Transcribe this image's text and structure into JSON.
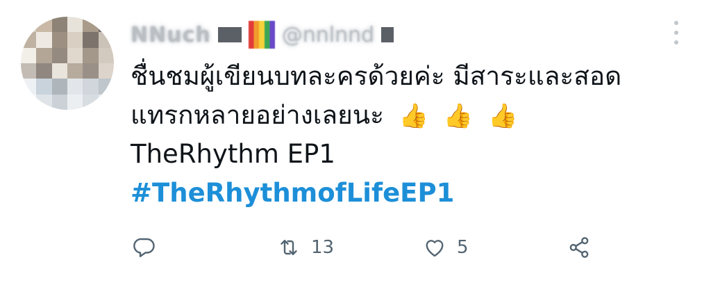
{
  "tweet": {
    "author": {
      "name_obscured": "NNuch",
      "handle_obscured": "@nnlnnd"
    },
    "text_lines": [
      "ชื่นชมผู้เขียนบทละครด้วยค่ะ มีสาระและสอด",
      "แทรกหลายอย่างเลยนะ",
      "TheRhythm EP1"
    ],
    "emoji": [
      "👍",
      "👍",
      "👍"
    ],
    "hashtag": "#TheRhythmofLifeEP1",
    "stats": {
      "retweets": "13",
      "likes": "5"
    }
  },
  "colors": {
    "hashtag": "#1d8fd8",
    "icon": "#536471",
    "text": "#0f1419"
  },
  "icons": {
    "reply": "reply-icon",
    "retweet": "retweet-icon",
    "like": "heart-icon",
    "share": "share-icon",
    "more": "more-options-icon"
  }
}
